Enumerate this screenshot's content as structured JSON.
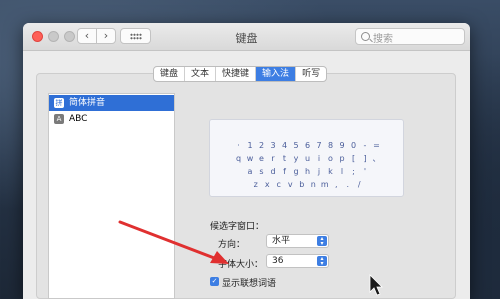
{
  "window": {
    "title": "键盘",
    "back_glyph": "‹",
    "forward_glyph": "›",
    "search_placeholder": "搜索"
  },
  "tabs": [
    {
      "label": "键盘",
      "active": false
    },
    {
      "label": "文本",
      "active": false
    },
    {
      "label": "快捷键",
      "active": false
    },
    {
      "label": "输入法",
      "active": true
    },
    {
      "label": "听写",
      "active": false
    }
  ],
  "sources": [
    {
      "icon_text": "拼",
      "label": "简体拼音",
      "selected": true
    },
    {
      "icon_text": "A",
      "label": "ABC",
      "selected": false
    }
  ],
  "keyboard": {
    "row1": [
      "·",
      "1",
      "2",
      "3",
      "4",
      "5",
      "6",
      "7",
      "8",
      "9",
      "0",
      "-",
      "="
    ],
    "row2": [
      "q",
      "w",
      "e",
      "r",
      "t",
      "y",
      "u",
      "i",
      "o",
      "p",
      "[",
      "]",
      "、"
    ],
    "row3": [
      "a",
      "s",
      "d",
      "f",
      "g",
      "h",
      "j",
      "k",
      "l",
      ";",
      "'"
    ],
    "row4": [
      "z",
      "x",
      "c",
      "v",
      "b",
      "n",
      "m",
      ",",
      ".",
      "/"
    ]
  },
  "options": {
    "candidate_window_label": "候选字窗口：",
    "orientation_label": "方向：",
    "orientation_value": "水平",
    "font_size_label": "字体大小：",
    "font_size_value": "36",
    "predictive_label": "显示联想词语",
    "predictive_checked": true
  },
  "annotation_color": "#e03030",
  "accent_color": "#3d7ee3"
}
